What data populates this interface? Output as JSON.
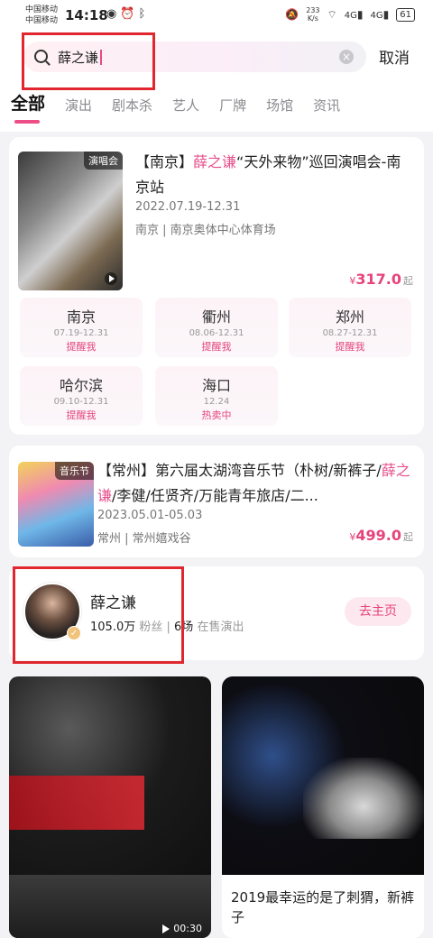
{
  "status": {
    "carrier1": "中国移动",
    "carrier2": "中国移动",
    "time": "14:18",
    "speed_value": "233",
    "speed_unit": "K/s",
    "net1": "4G",
    "net2": "4G",
    "battery": "61"
  },
  "search": {
    "query": "薛之谦",
    "cancel_label": "取消"
  },
  "tabs": [
    "全部",
    "演出",
    "剧本杀",
    "艺人",
    "厂牌",
    "场馆",
    "资讯"
  ],
  "event1": {
    "tag": "演唱会",
    "title_pre": "【南京】",
    "title_hl": "薛之谦",
    "title_post": "“天外来物”巡回演唱会-南京站",
    "date": "2022.07.19-12.31",
    "venue": "南京 | 南京奥体中心体育场",
    "price": "317.0",
    "currency": "¥",
    "price_unit": "起",
    "sessions": [
      {
        "city": "南京",
        "date": "07.19-12.31",
        "state": "提醒我"
      },
      {
        "city": "衢州",
        "date": "08.06-12.31",
        "state": "提醒我"
      },
      {
        "city": "郑州",
        "date": "08.27-12.31",
        "state": "提醒我"
      },
      {
        "city": "哈尔滨",
        "date": "09.10-12.31",
        "state": "提醒我"
      },
      {
        "city": "海口",
        "date": "12.24",
        "state": "热卖中"
      }
    ]
  },
  "event2": {
    "tag": "音乐节",
    "title_pre": "【常州】第六届太湖湾音乐节（朴树/新裤子/",
    "title_hl": "薛之谦",
    "title_post": "/李健/任贤齐/万能青年旅店/二...",
    "date": "2023.05.01-05.03",
    "venue": "常州 | 常州嬉戏谷",
    "price": "499.0",
    "currency": "¥",
    "price_unit": "起"
  },
  "artist": {
    "name": "薛之谦",
    "fans": "105.0万",
    "fans_label": "粉丝",
    "shows": "6场",
    "shows_label": "在售演出",
    "home_label": "去主页"
  },
  "video1": {
    "duration": "00:30"
  },
  "video2": {
    "caption": "2019最幸运的是了刺猬，新裤子"
  },
  "colors": {
    "accent": "#e6437c",
    "highlight_box": "#e0262e"
  }
}
